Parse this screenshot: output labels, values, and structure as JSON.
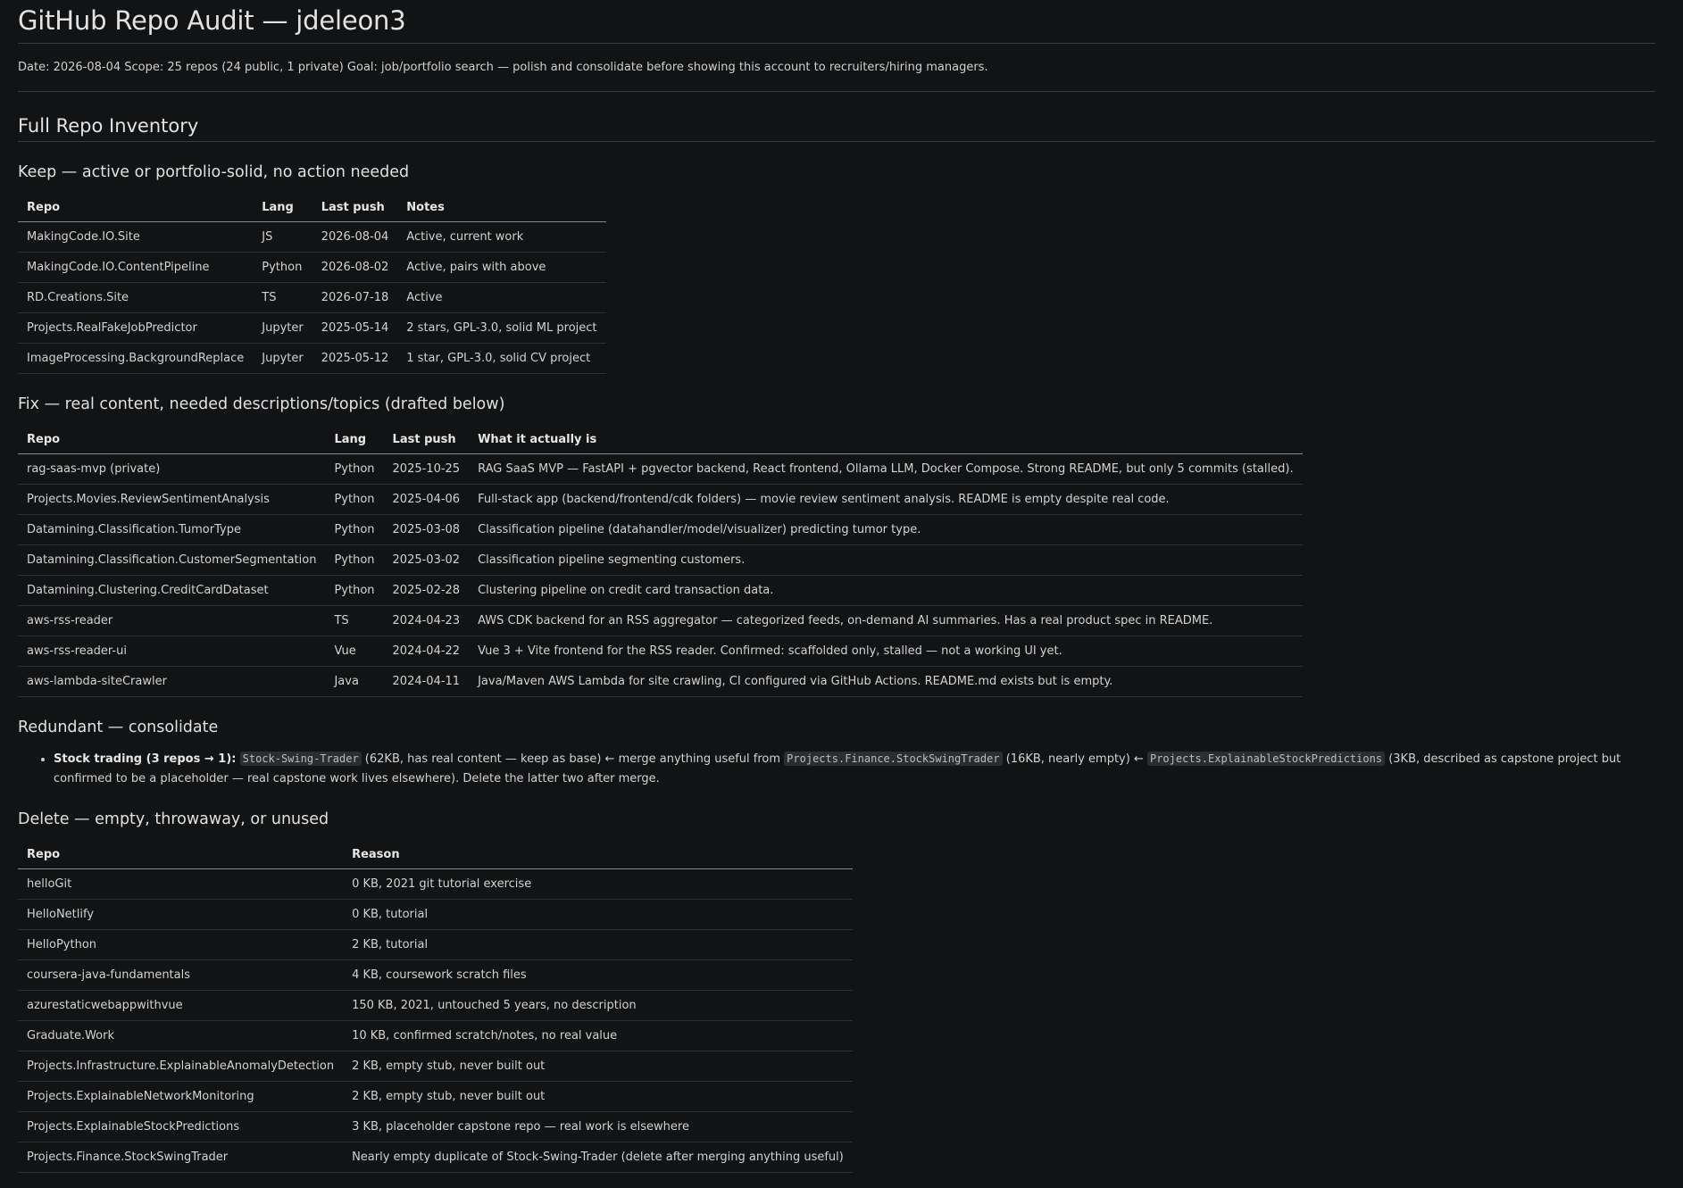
{
  "title": "GitHub Repo Audit — jdeleon3",
  "meta": "Date: 2026-08-04 Scope: 25 repos (24 public, 1 private) Goal: job/portfolio search — polish and consolidate before showing this account to recruiters/hiring managers.",
  "inventory_heading": "Full Repo Inventory",
  "keep": {
    "heading": "Keep — active or portfolio-solid, no action needed",
    "headers": [
      "Repo",
      "Lang",
      "Last push",
      "Notes"
    ],
    "rows": [
      [
        "MakingCode.IO.Site",
        "JS",
        "2026-08-04",
        "Active, current work"
      ],
      [
        "MakingCode.IO.ContentPipeline",
        "Python",
        "2026-08-02",
        "Active, pairs with above"
      ],
      [
        "RD.Creations.Site",
        "TS",
        "2026-07-18",
        "Active"
      ],
      [
        "Projects.RealFakeJobPredictor",
        "Jupyter",
        "2025-05-14",
        "2 stars, GPL-3.0, solid ML project"
      ],
      [
        "ImageProcessing.BackgroundReplace",
        "Jupyter",
        "2025-05-12",
        "1 star, GPL-3.0, solid CV project"
      ]
    ]
  },
  "fix": {
    "heading": "Fix — real content, needed descriptions/topics (drafted below)",
    "headers": [
      "Repo",
      "Lang",
      "Last push",
      "What it actually is"
    ],
    "rows": [
      [
        "rag-saas-mvp (private)",
        "Python",
        "2025-10-25",
        "RAG SaaS MVP — FastAPI + pgvector backend, React frontend, Ollama LLM, Docker Compose. Strong README, but only 5 commits (stalled)."
      ],
      [
        "Projects.Movies.ReviewSentimentAnalysis",
        "Python",
        "2025-04-06",
        "Full-stack app (backend/frontend/cdk folders) — movie review sentiment analysis. README is empty despite real code."
      ],
      [
        "Datamining.Classification.TumorType",
        "Python",
        "2025-03-08",
        "Classification pipeline (datahandler/model/visualizer) predicting tumor type."
      ],
      [
        "Datamining.Classification.CustomerSegmentation",
        "Python",
        "2025-03-02",
        "Classification pipeline segmenting customers."
      ],
      [
        "Datamining.Clustering.CreditCardDataset",
        "Python",
        "2025-02-28",
        "Clustering pipeline on credit card transaction data."
      ],
      [
        "aws-rss-reader",
        "TS",
        "2024-04-23",
        "AWS CDK backend for an RSS aggregator — categorized feeds, on-demand AI summaries. Has a real product spec in README."
      ],
      [
        "aws-rss-reader-ui",
        "Vue",
        "2024-04-22",
        "Vue 3 + Vite frontend for the RSS reader. Confirmed: scaffolded only, stalled — not a working UI yet."
      ],
      [
        "aws-lambda-siteCrawler",
        "Java",
        "2024-04-11",
        "Java/Maven AWS Lambda for site crawling, CI configured via GitHub Actions. README.md exists but is empty."
      ]
    ]
  },
  "redundant": {
    "heading": "Redundant — consolidate",
    "item": {
      "label": "Stock trading (3 repos → 1):",
      "code1": "Stock-Swing-Trader",
      "text1": " (62KB, has real content — keep as base) ← merge anything useful from ",
      "code2": "Projects.Finance.StockSwingTrader",
      "text2": " (16KB, nearly empty) ← ",
      "code3": "Projects.ExplainableStockPredictions",
      "text3": " (3KB, described as capstone project but confirmed to be a placeholder — real capstone work lives elsewhere). Delete the latter two after merge."
    }
  },
  "delete": {
    "heading": "Delete — empty, throwaway, or unused",
    "headers": [
      "Repo",
      "Reason"
    ],
    "rows": [
      [
        "helloGit",
        "0 KB, 2021 git tutorial exercise"
      ],
      [
        "HelloNetlify",
        "0 KB, tutorial"
      ],
      [
        "HelloPython",
        "2 KB, tutorial"
      ],
      [
        "coursera-java-fundamentals",
        "4 KB, coursework scratch files"
      ],
      [
        "azurestaticwebappwithvue",
        "150 KB, 2021, untouched 5 years, no description"
      ],
      [
        "Graduate.Work",
        "10 KB, confirmed scratch/notes, no real value"
      ],
      [
        "Projects.Infrastructure.ExplainableAnomalyDetection",
        "2 KB, empty stub, never built out"
      ],
      [
        "Projects.ExplainableNetworkMonitoring",
        "2 KB, empty stub, never built out"
      ],
      [
        "Projects.ExplainableStockPredictions",
        "3 KB, placeholder capstone repo — real work is elsewhere"
      ],
      [
        "Projects.Finance.StockSwingTrader",
        "Nearly empty duplicate of Stock-Swing-Trader (delete after merging anything useful)"
      ]
    ]
  }
}
